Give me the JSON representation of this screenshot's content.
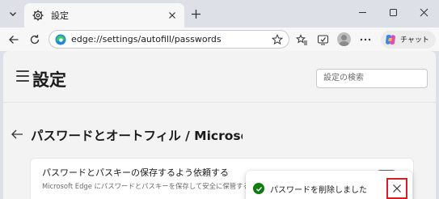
{
  "tab": {
    "title": "設定"
  },
  "address_bar": {
    "url": "edge://settings/autofill/passwords"
  },
  "toolbar": {
    "copilot_label": "チャット"
  },
  "page": {
    "title": "設定",
    "search_placeholder": "設定の検索",
    "section_title": "パスワードとオートフィル / Microsoft",
    "setting": {
      "title": "パスワードとパスキーの保存するよう依頼する",
      "description": "Microsoft Edge にパスワードとパスキーを保存して安全に保管することを許可します。",
      "toggle_on": false
    }
  },
  "toast": {
    "message": "パスワードを削除しました"
  },
  "colors": {
    "chrome_bg": "#dde1e7",
    "page_bg": "#f3f3f3",
    "success_green": "#107c10",
    "highlight_red": "#d81e1e"
  },
  "icons": [
    "tab-list-icon",
    "gear-icon",
    "close-icon",
    "plus-icon",
    "minimize-icon",
    "maximize-icon",
    "back-icon",
    "refresh-icon",
    "edge-logo-icon",
    "star-icon",
    "favorites-icon",
    "screenshot-icon",
    "avatar-icon",
    "more-icon",
    "copilot-icon",
    "hamburger-icon",
    "check-icon"
  ]
}
